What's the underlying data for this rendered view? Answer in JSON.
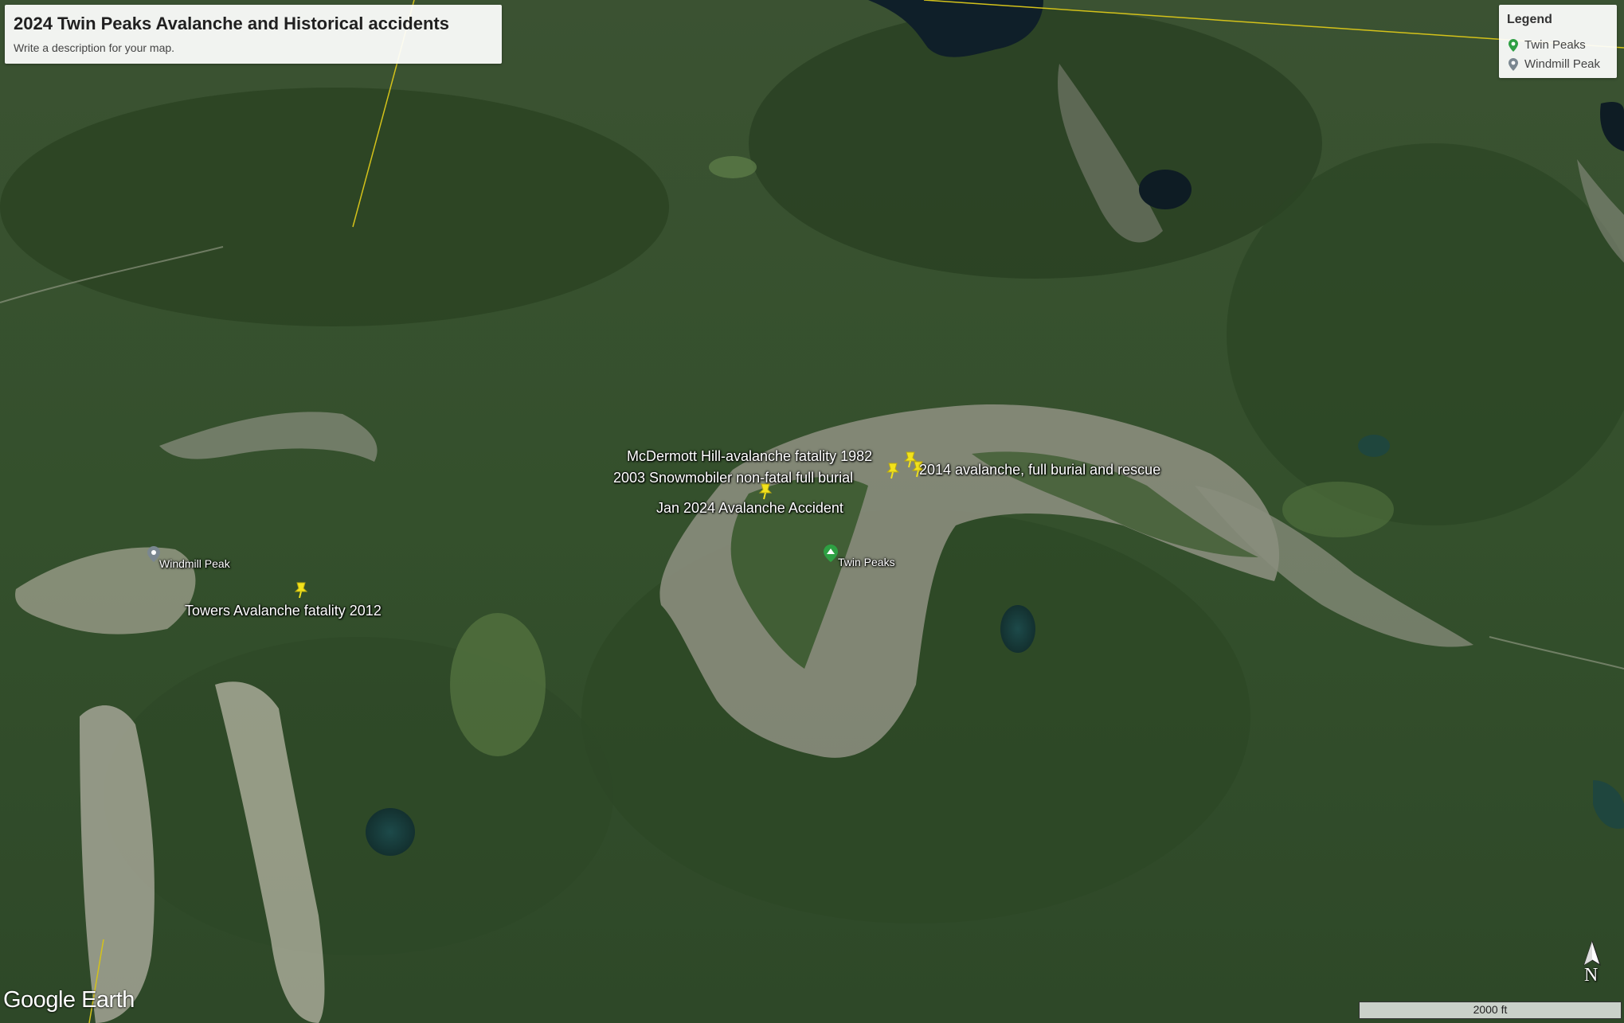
{
  "title_panel": {
    "title": "2024 Twin Peaks Avalanche and Historical accidents",
    "description": "Write a description for your map."
  },
  "legend": {
    "heading": "Legend",
    "items": [
      {
        "label": "Twin Peaks",
        "icon": "green-map-pin-icon",
        "color": "#2ea043"
      },
      {
        "label": "Windmill Peak",
        "icon": "gray-map-pin-icon",
        "color": "#7a8790"
      }
    ]
  },
  "placemarks": {
    "mcdermott": "McDermott Hill-avalanche fatality 1982",
    "snowmobiler": "2003 Snowmobiler non-fatal full burial",
    "jan2024": "Jan 2024 Avalanche Accident",
    "burial_2014": "2014 avalanche, full burial and rescue",
    "towers": "Towers Avalanche fatality 2012",
    "twin_peaks": "Twin Peaks",
    "windmill_peak": "Windmill Peak"
  },
  "branding": {
    "logo": "Google Earth"
  },
  "compass": {
    "label": "N"
  },
  "scale_bar": {
    "label": "2000 ft"
  },
  "colors": {
    "pushpin": "#f2e21b",
    "boundary_line": "#d4c21a"
  }
}
